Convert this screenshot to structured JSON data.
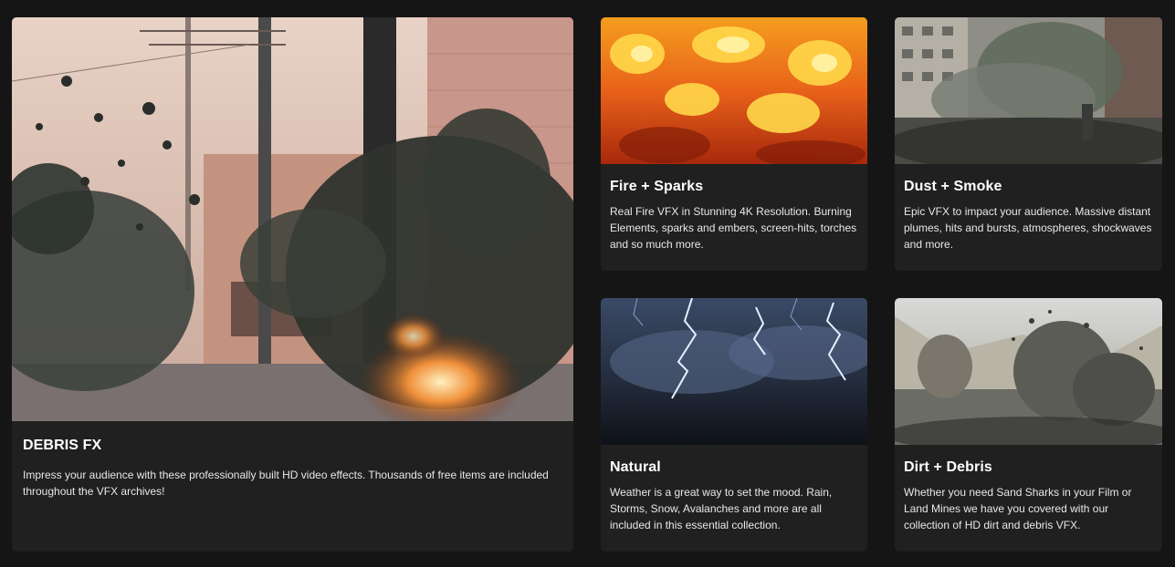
{
  "cards": [
    {
      "title": "DEBRIS FX",
      "description": "Impress your audience with these professionally built HD video effects. Thousands of free items are included throughout the VFX archives!",
      "image_icon": "explosion-street-image"
    },
    {
      "title": "Fire + Sparks",
      "description": "Real Fire VFX in Stunning 4K Resolution. Burning Elements, sparks and embers, screen-hits, torches and so much more.",
      "image_icon": "fire-image"
    },
    {
      "title": "Dust + Smoke",
      "description": "Epic VFX to impact your audience. Massive distant plumes, hits and bursts, atmospheres, shockwaves and more.",
      "image_icon": "dusty-street-image"
    },
    {
      "title": "Natural",
      "description": "Weather is a great way to set the mood. Rain, Storms, Snow, Avalanches and more are all included in this essential collection.",
      "image_icon": "lightning-storm-image"
    },
    {
      "title": "Dirt + Debris",
      "description": "Whether you need Sand Sharks in your Film or Land Mines we have you covered with our collection of HD dirt and debris VFX.",
      "image_icon": "dirt-explosion-image"
    }
  ],
  "colors": {
    "page_background": "#151515",
    "card_background": "#202020",
    "title_text": "#ffffff",
    "body_text": "#e8e8e8"
  }
}
